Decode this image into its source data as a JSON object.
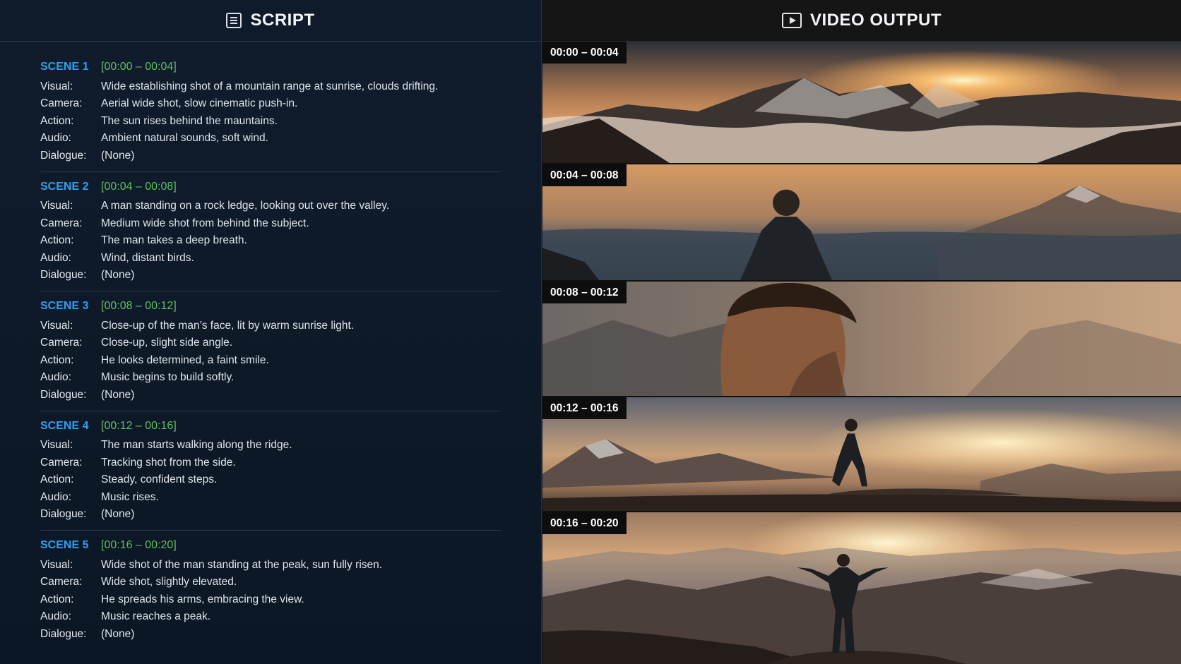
{
  "script_panel": {
    "title": "SCRIPT",
    "icon": "document-icon",
    "scenes": [
      {
        "name": "SCENE 1",
        "time": "[00:00 – 00:04]",
        "rows": [
          {
            "label": "Visual:",
            "value": "Wide establishing shot of a mountain range at sunrise, clouds drifting."
          },
          {
            "label": "Camera:",
            "value": "Aerial wide shot, slow cinematic push-in."
          },
          {
            "label": "Action:",
            "value": "The sun rises behind the mauntains."
          },
          {
            "label": "Audio:",
            "value": "Ambient natural sounds, soft wind."
          },
          {
            "label": "Dialogue:",
            "value": "(None)"
          }
        ]
      },
      {
        "name": "SCENE 2",
        "time": "[00:04 – 00:08]",
        "rows": [
          {
            "label": "Visual:",
            "value": "A man standing on a rock ledge, looking out over the valley."
          },
          {
            "label": "Camera:",
            "value": "Medium wide shot from behind the subject."
          },
          {
            "label": "Action:",
            "value": "The man takes a deep breath."
          },
          {
            "label": "Audio:",
            "value": "Wind, distant birds."
          },
          {
            "label": "Dialogue:",
            "value": "(None)"
          }
        ]
      },
      {
        "name": "SCENE 3",
        "time": "[00:08 – 00:12]",
        "rows": [
          {
            "label": "Visual:",
            "value": "Close-up of the man’s face, lit by warm sunrise light."
          },
          {
            "label": "Camera:",
            "value": "Close-up, slight side angle."
          },
          {
            "label": "Action:",
            "value": "He looks determined, a faint smile."
          },
          {
            "label": "Audio:",
            "value": "Music begins to build softly."
          },
          {
            "label": "Dialogue:",
            "value": "(None)"
          }
        ]
      },
      {
        "name": "SCENE 4",
        "time": "[00:12 – 00:16]",
        "rows": [
          {
            "label": "Visual:",
            "value": "The man starts walking along the ridge."
          },
          {
            "label": "Camera:",
            "value": "Tracking shot from the side."
          },
          {
            "label": "Action:",
            "value": "Steady, confident steps."
          },
          {
            "label": "Audio:",
            "value": "Music rises."
          },
          {
            "label": "Dialogue:",
            "value": "(None)"
          }
        ]
      },
      {
        "name": "SCENE 5",
        "time": "[00:16 – 00:20]",
        "rows": [
          {
            "label": "Visual:",
            "value": "Wide shot of the man standing at the peak, sun fully risen."
          },
          {
            "label": "Camera:",
            "value": "Wide shot, slightly elevated."
          },
          {
            "label": "Action:",
            "value": "He spreads his arms, embracing the view."
          },
          {
            "label": "Audio:",
            "value": "Music reaches a peak."
          },
          {
            "label": "Dialogue:",
            "value": "(None)"
          }
        ]
      }
    ]
  },
  "video_panel": {
    "title": "VIDEO OUTPUT",
    "icon": "play-icon",
    "frames": [
      {
        "timestamp": "00:00 – 00:04",
        "subject": "mountain-sunrise-clouds"
      },
      {
        "timestamp": "00:04 – 00:08",
        "subject": "man-from-behind"
      },
      {
        "timestamp": "00:08 – 00:12",
        "subject": "man-face-closeup"
      },
      {
        "timestamp": "00:12 – 00:16",
        "subject": "man-walking-ridge"
      },
      {
        "timestamp": "00:16 – 00:20",
        "subject": "man-arms-spread-peak"
      }
    ]
  },
  "colors": {
    "scene_name": "#2f9ff0",
    "scene_time": "#5fbf60",
    "left_bg": "#0c1725",
    "right_bg": "#151515"
  }
}
